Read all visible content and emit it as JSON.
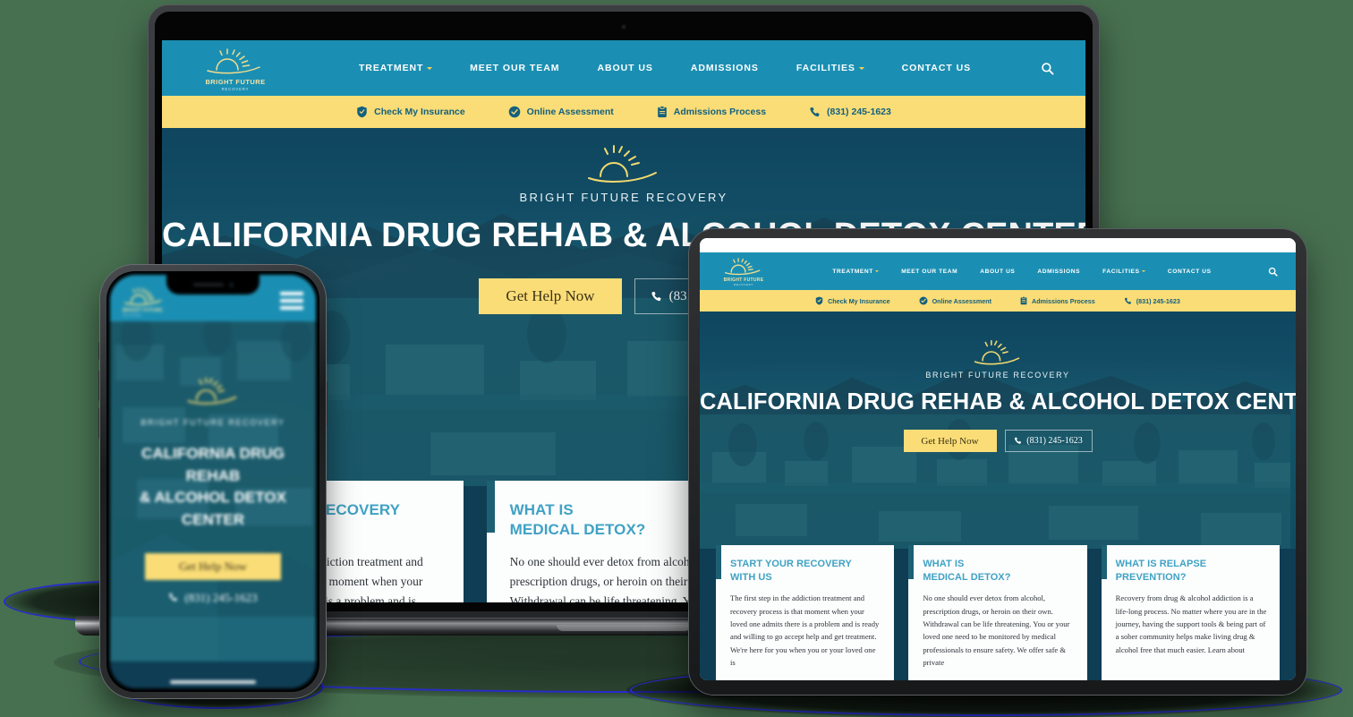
{
  "page": {
    "background_color": "#477050",
    "description": "Responsive website mockup shown on laptop, tablet and phone"
  },
  "brand": {
    "name": "BRIGHT FUTURE",
    "subtitle": "RECOVERY",
    "logo_icon": "sunrise-icon",
    "colors": {
      "nav_blue": "#1b8fb3",
      "cta_yellow": "#fadd77",
      "deep_teal": "#14607e",
      "heading_blue": "#3fa2c4",
      "accent_bar": "#1d6073"
    }
  },
  "nav": {
    "items": [
      {
        "label": "TREATMENT",
        "has_dropdown": true
      },
      {
        "label": "MEET OUR TEAM",
        "has_dropdown": false
      },
      {
        "label": "ABOUT US",
        "has_dropdown": false
      },
      {
        "label": "ADMISSIONS",
        "has_dropdown": false
      },
      {
        "label": "FACILITIES",
        "has_dropdown": true
      },
      {
        "label": "CONTACT US",
        "has_dropdown": false
      }
    ],
    "search_icon": "search-icon"
  },
  "cta_bar": {
    "items": [
      {
        "label": "Check My Insurance",
        "icon": "shield-icon"
      },
      {
        "label": "Online Assessment",
        "icon": "check-circle-icon"
      },
      {
        "label": "Admissions Process",
        "icon": "clipboard-icon"
      },
      {
        "label": "(831) 245-1623",
        "icon": "phone-icon"
      }
    ]
  },
  "hero": {
    "logo_icon": "sunrise-icon",
    "brand_line": "BRIGHT FUTURE RECOVERY",
    "title": "CALIFORNIA DRUG REHAB & ALCOHOL DETOX CENTER",
    "title_line1": "CALIFORNIA DRUG REHAB",
    "title_line2": "& ALCOHOL DETOX CENTER",
    "primary_button": "Get Help Now",
    "phone_button": "(831) 245-1623",
    "phone_icon": "phone-icon"
  },
  "cards": [
    {
      "title": "START YOUR RECOVERY WITH US",
      "title_line1": "START YOUR RECOVERY",
      "title_line2": "WITH US",
      "body": "The first step in the addiction treatment and recovery process is that moment when your loved one admits there is a problem and is ready and willing to go accept help and get treatment. We're here for you when you or your loved one is"
    },
    {
      "title": "WHAT IS MEDICAL DETOX?",
      "title_line1": "WHAT IS",
      "title_line2": "MEDICAL DETOX?",
      "body": "No one should ever detox from alcohol, prescription drugs, or heroin on their own. Withdrawal can be life threatening. You or your loved one need to be monitored by medical professionals to ensure safety. We offer safe & private"
    },
    {
      "title": "WHAT IS RELAPSE PREVENTION?",
      "title_line1": "WHAT IS RELAPSE",
      "title_line2": "PREVENTION?",
      "body": "Recovery from drug & alcohol addiction is a life-long process. No matter where you are in the journey, having the support tools & being part of a sober community helps make living drug & alcohol free that much easier. Learn about"
    }
  ],
  "devices": [
    {
      "name": "laptop",
      "label": "Laptop"
    },
    {
      "name": "tablet",
      "label": "Tablet"
    },
    {
      "name": "phone",
      "label": "Phone"
    }
  ]
}
